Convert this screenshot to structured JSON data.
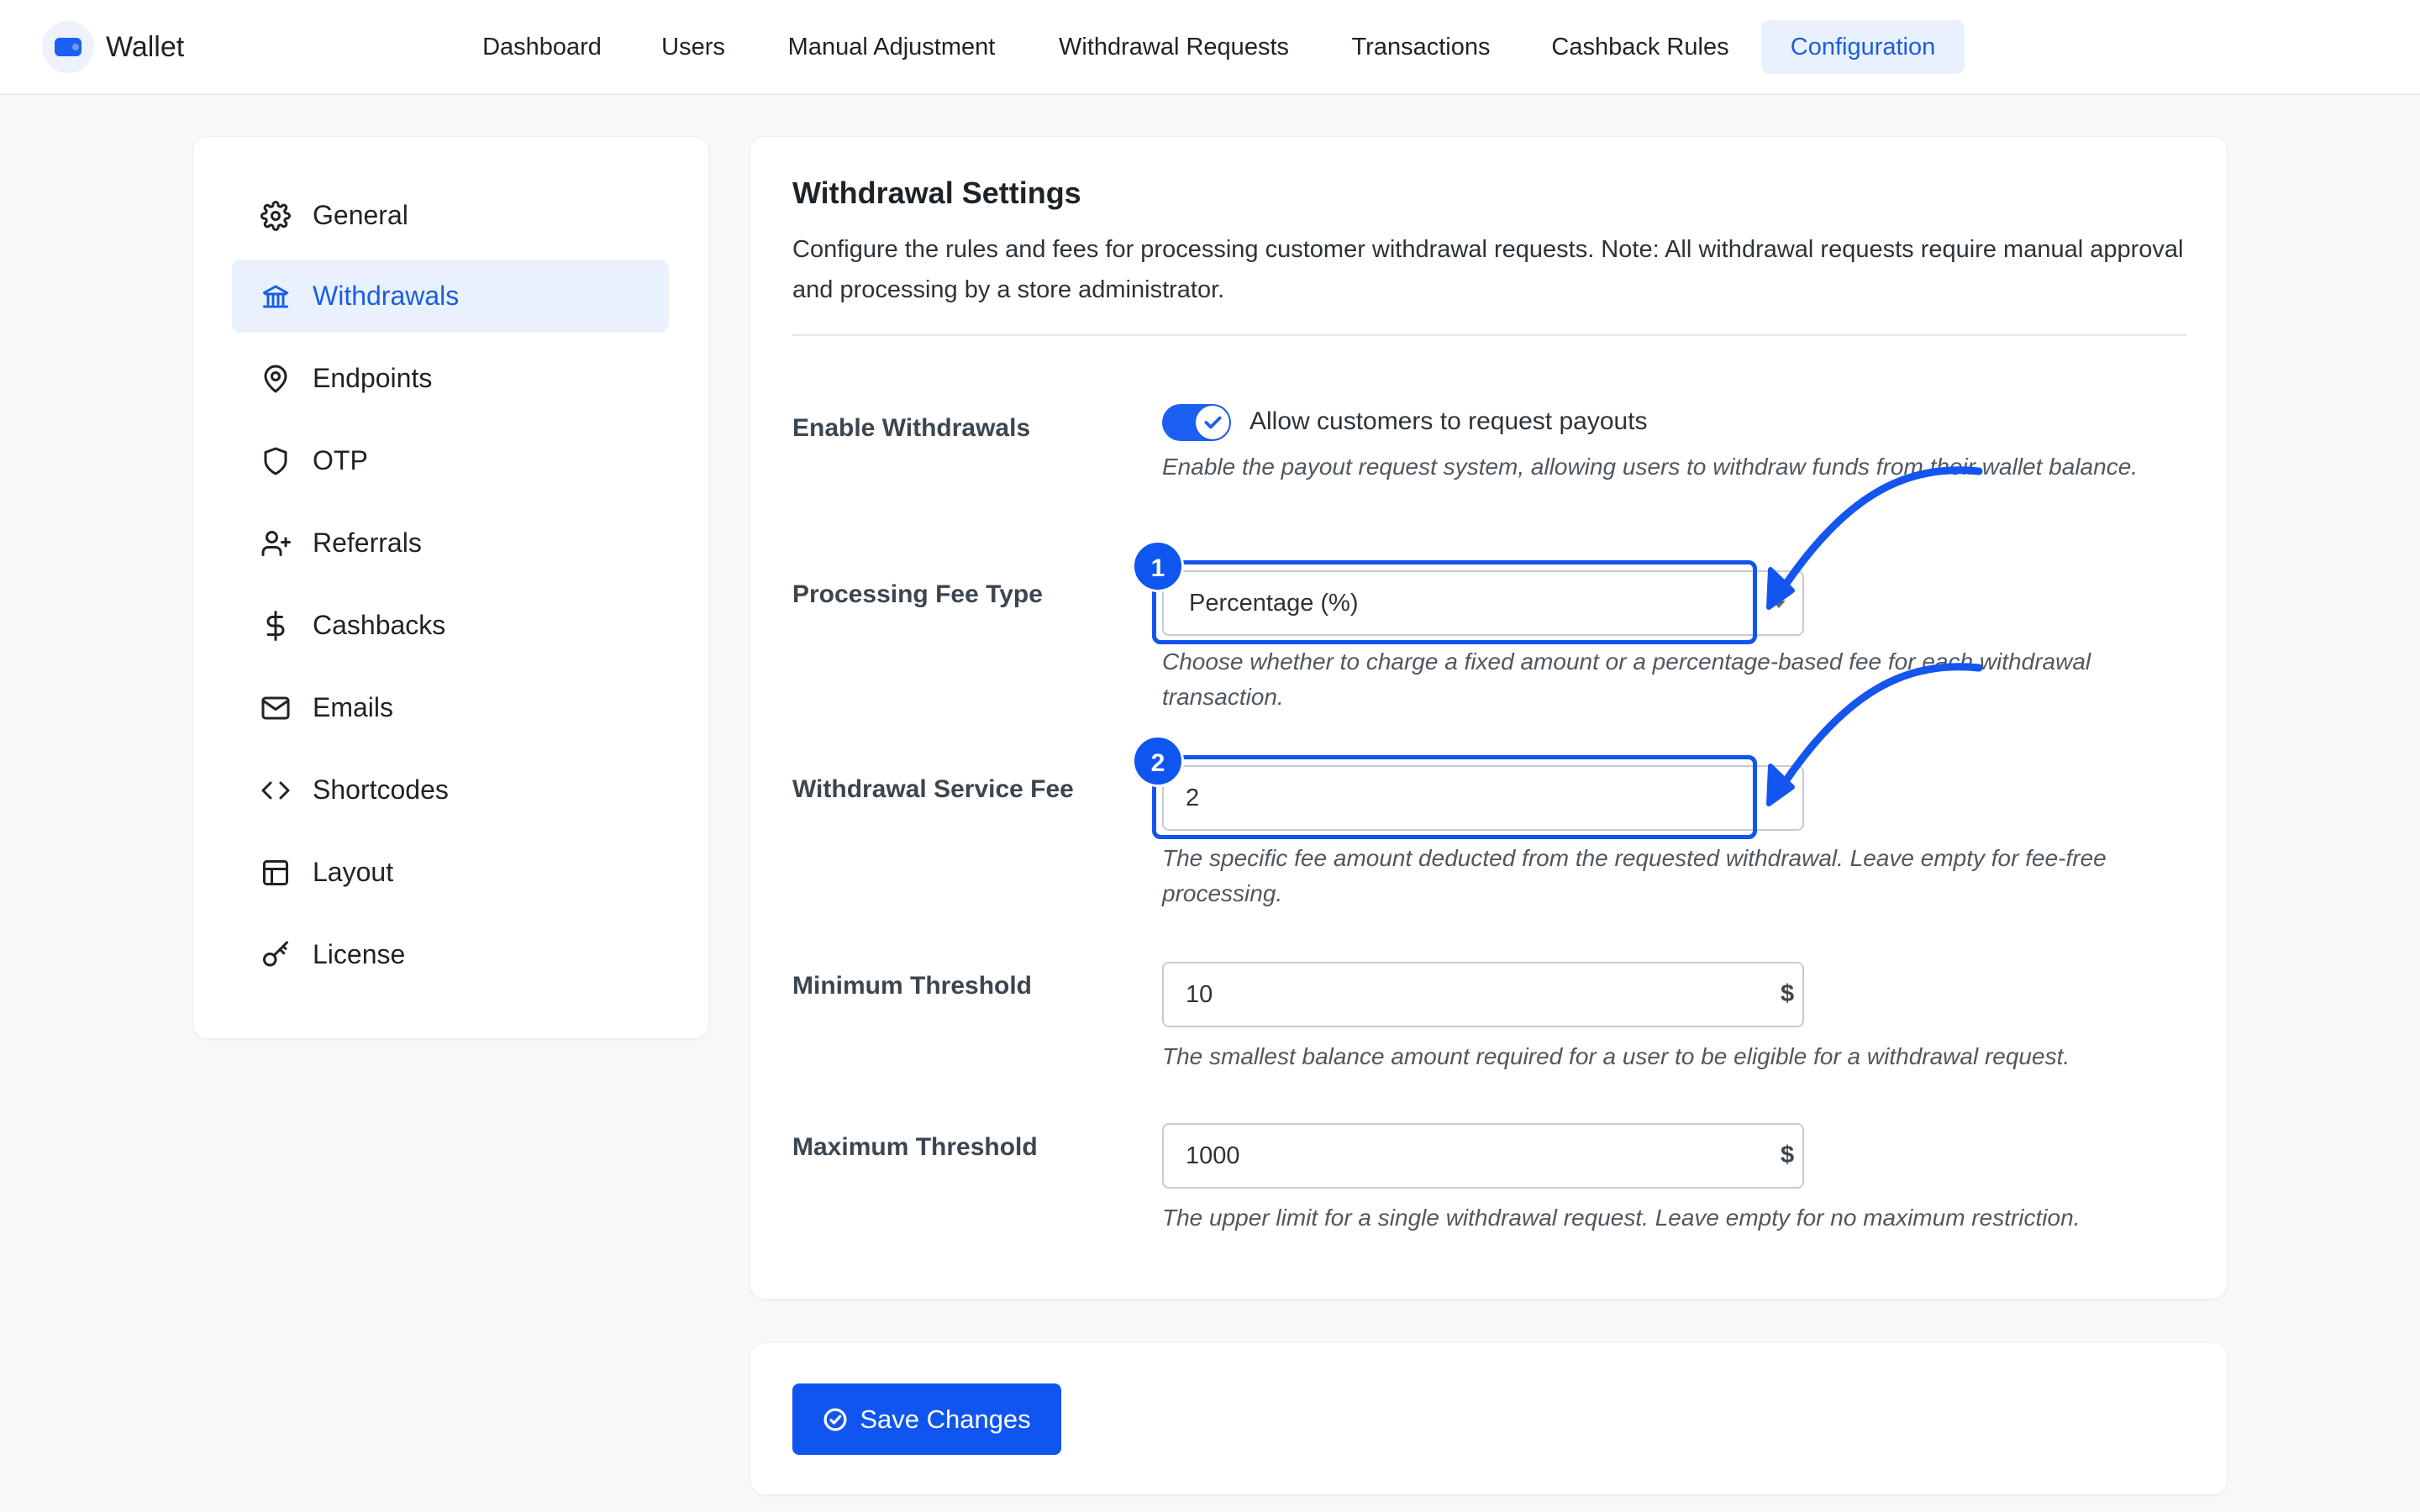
{
  "brand": {
    "name": "Wallet"
  },
  "nav": [
    {
      "label": "Dashboard"
    },
    {
      "label": "Users"
    },
    {
      "label": "Manual Adjustment"
    },
    {
      "label": "Withdrawal Requests"
    },
    {
      "label": "Transactions"
    },
    {
      "label": "Cashback Rules"
    },
    {
      "label": "Configuration",
      "active": true
    }
  ],
  "sidebar": {
    "items": [
      {
        "label": "General",
        "icon": "gear-icon"
      },
      {
        "label": "Withdrawals",
        "icon": "bank-icon",
        "active": true
      },
      {
        "label": "Endpoints",
        "icon": "map-pin-icon"
      },
      {
        "label": "OTP",
        "icon": "shield-icon"
      },
      {
        "label": "Referrals",
        "icon": "user-plus-icon"
      },
      {
        "label": "Cashbacks",
        "icon": "dollar-icon"
      },
      {
        "label": "Emails",
        "icon": "mail-icon"
      },
      {
        "label": "Shortcodes",
        "icon": "code-icon"
      },
      {
        "label": "Layout",
        "icon": "layout-icon"
      },
      {
        "label": "License",
        "icon": "key-icon"
      }
    ]
  },
  "settings": {
    "title": "Withdrawal Settings",
    "description": "Configure the rules and fees for processing customer withdrawal requests. Note: All withdrawal requests require manual approval and processing by a store administrator.",
    "enable": {
      "label": "Enable Withdrawals",
      "toggle_text": "Allow customers to request payouts",
      "checked": true,
      "help": "Enable the payout request system, allowing users to withdraw funds from their wallet balance."
    },
    "fee_type": {
      "label": "Processing Fee Type",
      "value": "Percentage (%)",
      "help": "Choose whether to charge a fixed amount or a percentage-based fee for each withdrawal transaction."
    },
    "service_fee": {
      "label": "Withdrawal Service Fee",
      "value": "2",
      "help": "The specific fee amount deducted from the requested withdrawal. Leave empty for fee-free processing."
    },
    "min_threshold": {
      "label": "Minimum Threshold",
      "value": "10",
      "unit": "$",
      "help": "The smallest balance amount required for a user to be eligible for a withdrawal request."
    },
    "max_threshold": {
      "label": "Maximum Threshold",
      "value": "1000",
      "unit": "$",
      "help": "The upper limit for a single withdrawal request. Leave empty for no maximum restriction."
    }
  },
  "annotations": {
    "badge1": "1",
    "badge2": "2"
  },
  "save": {
    "label": "Save Changes"
  },
  "colors": {
    "accent": "#1c5ff3",
    "active_bg": "#eaf1fe",
    "annotation": "#1355ee"
  }
}
